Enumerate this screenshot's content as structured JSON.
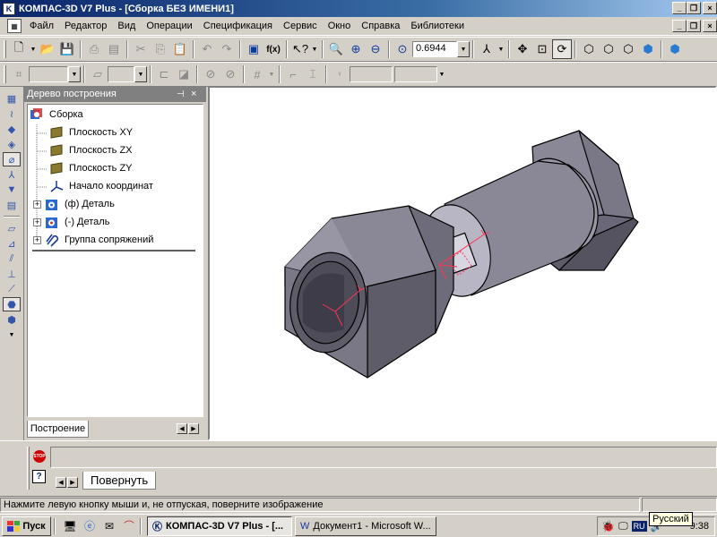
{
  "window": {
    "title": "КОМПАС-3D V7 Plus - [Сборка БЕЗ ИМЕНИ1]",
    "minimize": "_",
    "restore": "❐",
    "close": "×"
  },
  "menu": {
    "items": [
      "Файл",
      "Редактор",
      "Вид",
      "Операции",
      "Спецификация",
      "Сервис",
      "Окно",
      "Справка",
      "Библиотеки"
    ]
  },
  "toolbar": {
    "zoom_value": "0.6944",
    "fx_label": "f(x)"
  },
  "tree": {
    "header": "Дерево построения",
    "pin_icon": "pin-icon",
    "close_icon": "close-icon",
    "items": [
      {
        "label": "Сборка",
        "icon": "assembly-icon",
        "expander": ""
      },
      {
        "label": "Плоскость XY",
        "icon": "plane-icon",
        "expander": ""
      },
      {
        "label": "Плоскость ZX",
        "icon": "plane-icon",
        "expander": ""
      },
      {
        "label": "Плоскость ZY",
        "icon": "plane-icon",
        "expander": ""
      },
      {
        "label": "Начало координат",
        "icon": "origin-icon",
        "expander": ""
      },
      {
        "label": "(ф) Деталь",
        "icon": "part-icon",
        "expander": "+"
      },
      {
        "label": "(-) Деталь",
        "icon": "part-icon",
        "expander": "+"
      },
      {
        "label": "Группа сопряжений",
        "icon": "mates-icon",
        "expander": "+"
      }
    ],
    "tab_label": "Построение"
  },
  "command": {
    "stop_label": "STOP",
    "help_label": "?",
    "tab_label": "Повернуть"
  },
  "status": {
    "message": "Нажмите левую кнопку мыши и, не отпуская, поверните изображение"
  },
  "taskbar": {
    "start_label": "Пуск",
    "tasks": [
      {
        "label": "КОМПАС-3D V7 Plus - [...",
        "active": true
      },
      {
        "label": "Документ1 - Microsoft W...",
        "active": false
      }
    ],
    "lang": "RU",
    "clock": "9:38",
    "tooltip": "Русский"
  },
  "colors": {
    "title_active": "#0a246a",
    "face": "#d4d0c8",
    "model_face": "#8a8896",
    "model_dark": "#5e5c68",
    "model_light": "#b8b6c4",
    "csys_marker": "#ff3355"
  }
}
